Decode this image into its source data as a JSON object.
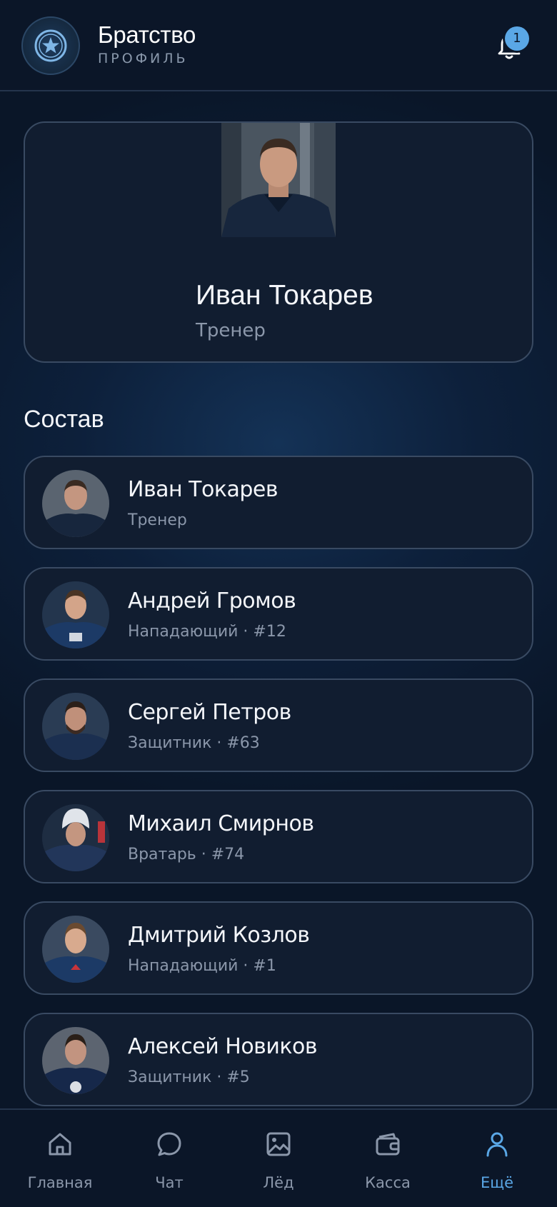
{
  "header": {
    "title": "Братство",
    "subtitle": "ПРОФИЛЬ",
    "notification_count": "1"
  },
  "profile": {
    "name": "Иван Токарев",
    "role": "Тренер"
  },
  "roster": {
    "title": "Состав",
    "items": [
      {
        "name": "Иван Токарев",
        "sub": "Тренер"
      },
      {
        "name": "Андрей Громов",
        "sub": "Нападающий · #12"
      },
      {
        "name": "Сергей Петров",
        "sub": "Защитник · #63"
      },
      {
        "name": "Михаил Смирнов",
        "sub": "Вратарь · #74"
      },
      {
        "name": "Дмитрий Козлов",
        "sub": "Нападающий · #1"
      },
      {
        "name": "Алексей Новиков",
        "sub": "Защитник · #5"
      }
    ]
  },
  "tabs": [
    {
      "label": "Главная",
      "icon": "home-icon"
    },
    {
      "label": "Чат",
      "icon": "chat-icon"
    },
    {
      "label": "Лёд",
      "icon": "image-icon"
    },
    {
      "label": "Касса",
      "icon": "wallet-icon"
    },
    {
      "label": "Ещё",
      "icon": "user-icon"
    }
  ],
  "colors": {
    "accent": "#5aa7e6",
    "background": "#0a1628",
    "card": "#111d30"
  }
}
